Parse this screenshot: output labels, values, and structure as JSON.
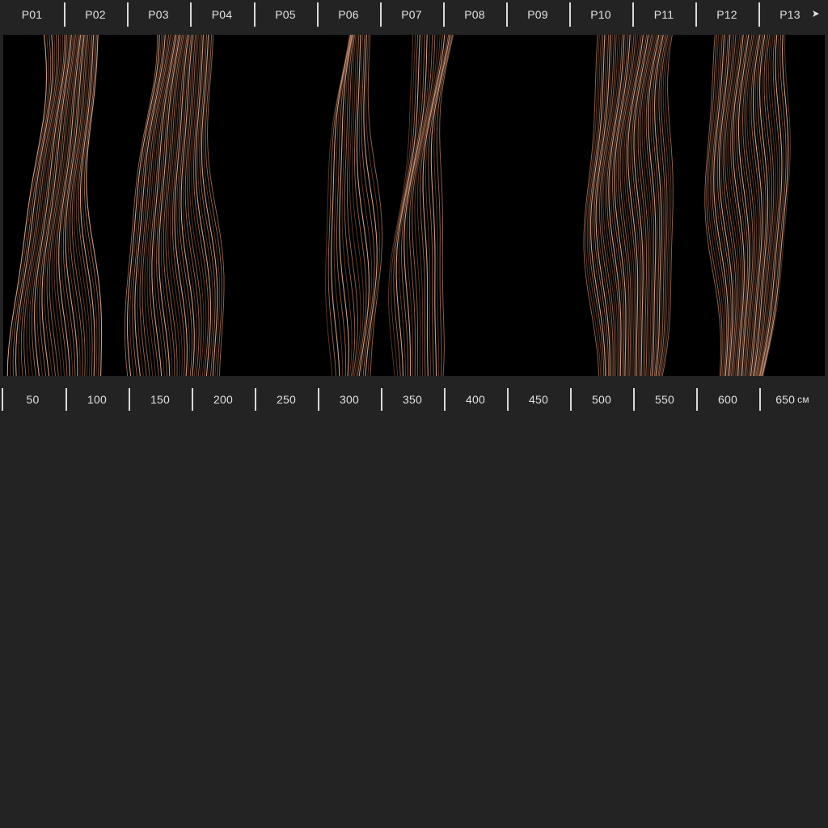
{
  "panel_labels": [
    "P01",
    "P02",
    "P03",
    "P04",
    "P05",
    "P06",
    "P07",
    "P08",
    "P09",
    "P10",
    "P11",
    "P12",
    "P13"
  ],
  "scale_labels": [
    "50",
    "100",
    "150",
    "200",
    "250",
    "300",
    "350",
    "400",
    "450",
    "500",
    "550",
    "600",
    "650"
  ],
  "scale_unit": "см",
  "next_icon": "arrow-right-icon",
  "colors": {
    "background": "#232323",
    "panel": "#000000",
    "text": "#e2e2e2",
    "separator": "#d9d9d9",
    "strand_dark": "#6b4330",
    "strand_mid": "#a8725a",
    "strand_light": "#e2ae92"
  }
}
